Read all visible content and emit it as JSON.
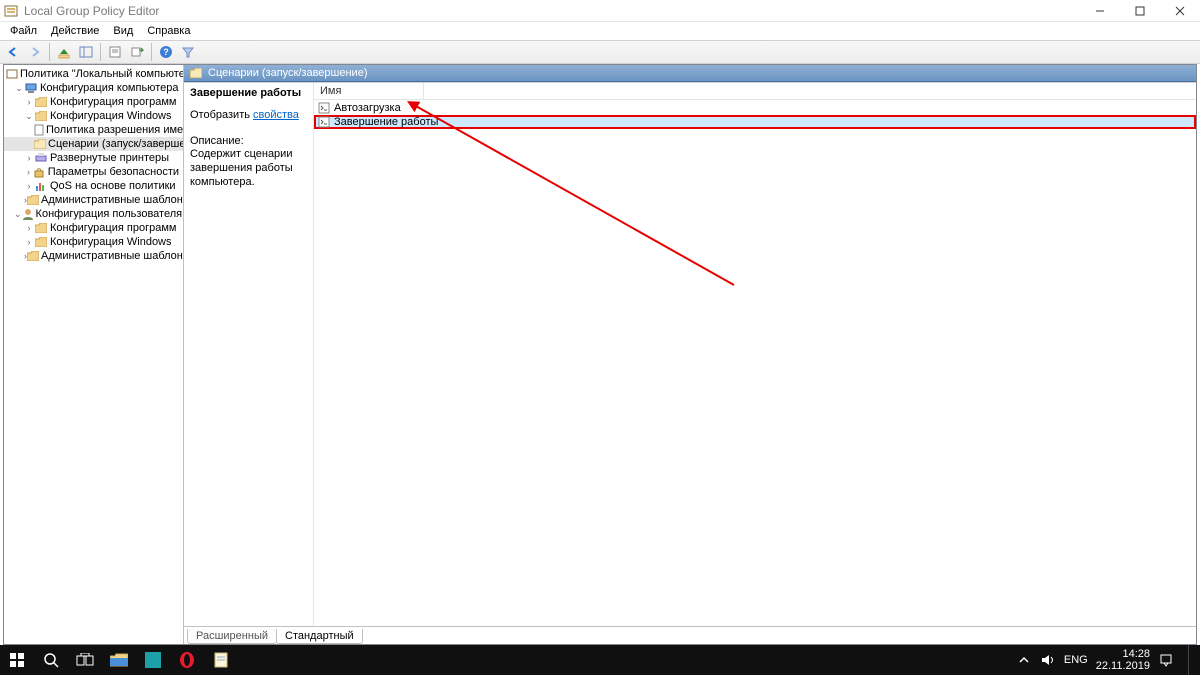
{
  "window": {
    "title": "Local Group Policy Editor"
  },
  "menu": {
    "file": "Файл",
    "action": "Действие",
    "view": "Вид",
    "help": "Справка"
  },
  "tree": {
    "root": "Политика \"Локальный компьютер\"",
    "computer_config": "Конфигурация компьютера",
    "software_settings": "Конфигурация программ",
    "windows_settings": "Конфигурация Windows",
    "name_resolution": "Политика разрешения имен",
    "scripts": "Сценарии (запуск/завершение)",
    "deployed_printers": "Развернутые принтеры",
    "security_settings": "Параметры безопасности",
    "policy_based_qos": "QoS на основе политики",
    "admin_templates_c": "Административные шаблоны",
    "user_config": "Конфигурация пользователя",
    "software_settings_u": "Конфигурация программ",
    "windows_settings_u": "Конфигурация Windows",
    "admin_templates_u": "Административные шаблоны"
  },
  "right": {
    "header": "Сценарии (запуск/завершение)",
    "detail_title": "Завершение работы",
    "show_label": "Отобразить",
    "show_link": "свойства",
    "desc_label": "Описание:",
    "desc_text": "Содержит сценарии завершения работы компьютера.",
    "col_name": "Имя",
    "items": [
      {
        "label": "Автозагрузка"
      },
      {
        "label": "Завершение работы"
      }
    ]
  },
  "tabs": {
    "extended": "Расширенный",
    "standard": "Стандартный"
  },
  "taskbar": {
    "lang": "ENG",
    "time": "14:28",
    "date": "22.11.2019"
  }
}
